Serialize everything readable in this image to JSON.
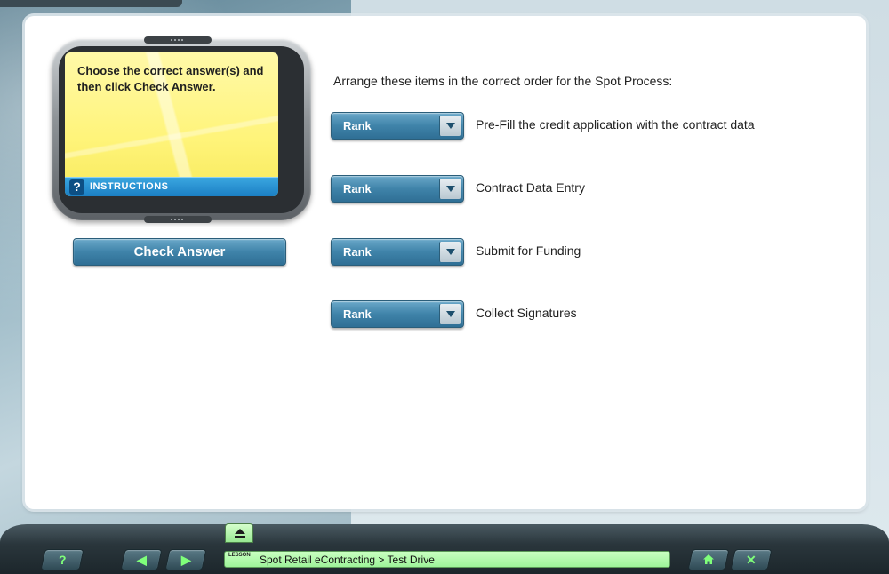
{
  "instructions": {
    "text": "Choose the correct answer(s) and then click Check Answer.",
    "label": "INSTRUCTIONS",
    "help_glyph": "?"
  },
  "check_answer_label": "Check Answer",
  "question": "Arrange these items in the correct order for the Spot Process:",
  "items": [
    {
      "rank_label": "Rank",
      "text": "Pre-Fill the credit application with the contract data"
    },
    {
      "rank_label": "Rank",
      "text": "Contract Data Entry"
    },
    {
      "rank_label": "Rank",
      "text": "Submit for Funding"
    },
    {
      "rank_label": "Rank",
      "text": "Collect Signatures"
    }
  ],
  "bottom_bar": {
    "help_label": "?",
    "back_icon": "◀",
    "forward_icon": "▶",
    "lesson_tag": "LESSON",
    "lesson_title": "Spot Retail eContracting > Test Drive",
    "home_icon": "home-icon",
    "close_label": "✕"
  },
  "colors": {
    "accent_blue": "#3f83a9",
    "screen_yellow": "#fff47a",
    "lesson_green": "#9ef39a"
  }
}
